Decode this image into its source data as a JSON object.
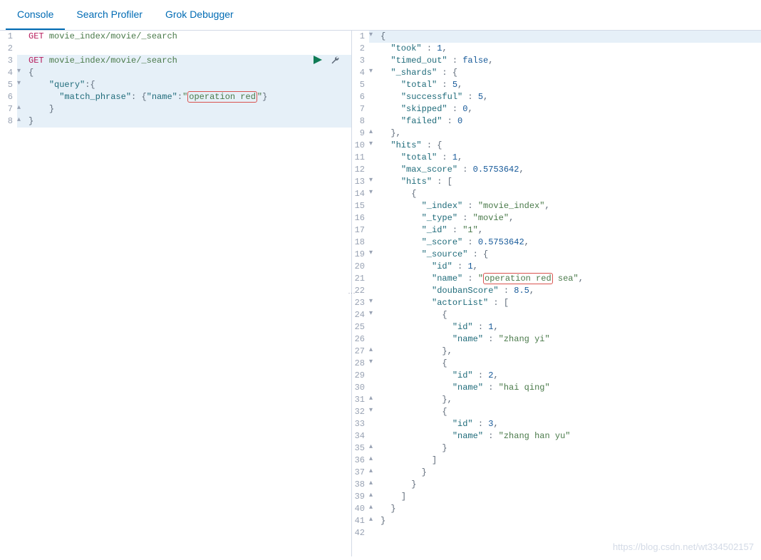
{
  "tabs": {
    "console": "Console",
    "profiler": "Search Profiler",
    "grok": "Grok Debugger"
  },
  "left": {
    "lines": [
      {
        "n": "1",
        "fold": "",
        "hl": false,
        "tokens": [
          [
            "method",
            "GET"
          ],
          [
            "plain",
            " "
          ],
          [
            "path",
            "movie_index/movie/_search"
          ]
        ]
      },
      {
        "n": "2",
        "fold": "",
        "hl": false,
        "tokens": []
      },
      {
        "n": "3",
        "fold": "",
        "hl": true,
        "tokens": [
          [
            "method",
            "GET"
          ],
          [
            "plain",
            " "
          ],
          [
            "path",
            "movie_index/movie/_search"
          ]
        ]
      },
      {
        "n": "4",
        "fold": "▾",
        "hl": true,
        "tokens": [
          [
            "punc",
            "{"
          ]
        ]
      },
      {
        "n": "5",
        "fold": "▾",
        "hl": true,
        "tokens": [
          [
            "plain",
            "    "
          ],
          [
            "key",
            "\"query\""
          ],
          [
            "punc",
            ":{"
          ]
        ]
      },
      {
        "n": "6",
        "fold": "",
        "hl": true,
        "tokens": [
          [
            "plain",
            "      "
          ],
          [
            "key",
            "\"match_phrase\""
          ],
          [
            "punc",
            ": {"
          ],
          [
            "key",
            "\"name\""
          ],
          [
            "punc",
            ":"
          ],
          [
            "str",
            "\""
          ],
          [
            "strbox",
            "operation red"
          ],
          [
            "str",
            "\""
          ],
          [
            "punc",
            "}"
          ]
        ]
      },
      {
        "n": "7",
        "fold": "▴",
        "hl": true,
        "tokens": [
          [
            "plain",
            "    "
          ],
          [
            "punc",
            "}"
          ]
        ]
      },
      {
        "n": "8",
        "fold": "▴",
        "hl": true,
        "tokens": [
          [
            "punc",
            "}"
          ]
        ]
      }
    ]
  },
  "right": {
    "lines": [
      {
        "n": "1",
        "fold": "▾",
        "tokens": [
          [
            "punc",
            "{"
          ]
        ],
        "hl": true
      },
      {
        "n": "2",
        "fold": "",
        "tokens": [
          [
            "plain",
            "  "
          ],
          [
            "key",
            "\"took\""
          ],
          [
            "punc",
            " : "
          ],
          [
            "num",
            "1"
          ],
          [
            "punc",
            ","
          ]
        ]
      },
      {
        "n": "3",
        "fold": "",
        "tokens": [
          [
            "plain",
            "  "
          ],
          [
            "key",
            "\"timed_out\""
          ],
          [
            "punc",
            " : "
          ],
          [
            "bool",
            "false"
          ],
          [
            "punc",
            ","
          ]
        ]
      },
      {
        "n": "4",
        "fold": "▾",
        "tokens": [
          [
            "plain",
            "  "
          ],
          [
            "key",
            "\"_shards\""
          ],
          [
            "punc",
            " : {"
          ]
        ]
      },
      {
        "n": "5",
        "fold": "",
        "tokens": [
          [
            "plain",
            "    "
          ],
          [
            "key",
            "\"total\""
          ],
          [
            "punc",
            " : "
          ],
          [
            "num",
            "5"
          ],
          [
            "punc",
            ","
          ]
        ]
      },
      {
        "n": "6",
        "fold": "",
        "tokens": [
          [
            "plain",
            "    "
          ],
          [
            "key",
            "\"successful\""
          ],
          [
            "punc",
            " : "
          ],
          [
            "num",
            "5"
          ],
          [
            "punc",
            ","
          ]
        ]
      },
      {
        "n": "7",
        "fold": "",
        "tokens": [
          [
            "plain",
            "    "
          ],
          [
            "key",
            "\"skipped\""
          ],
          [
            "punc",
            " : "
          ],
          [
            "num",
            "0"
          ],
          [
            "punc",
            ","
          ]
        ]
      },
      {
        "n": "8",
        "fold": "",
        "tokens": [
          [
            "plain",
            "    "
          ],
          [
            "key",
            "\"failed\""
          ],
          [
            "punc",
            " : "
          ],
          [
            "num",
            "0"
          ]
        ]
      },
      {
        "n": "9",
        "fold": "▴",
        "tokens": [
          [
            "plain",
            "  "
          ],
          [
            "punc",
            "},"
          ]
        ]
      },
      {
        "n": "10",
        "fold": "▾",
        "tokens": [
          [
            "plain",
            "  "
          ],
          [
            "key",
            "\"hits\""
          ],
          [
            "punc",
            " : {"
          ]
        ]
      },
      {
        "n": "11",
        "fold": "",
        "tokens": [
          [
            "plain",
            "    "
          ],
          [
            "key",
            "\"total\""
          ],
          [
            "punc",
            " : "
          ],
          [
            "num",
            "1"
          ],
          [
            "punc",
            ","
          ]
        ]
      },
      {
        "n": "12",
        "fold": "",
        "tokens": [
          [
            "plain",
            "    "
          ],
          [
            "key",
            "\"max_score\""
          ],
          [
            "punc",
            " : "
          ],
          [
            "num",
            "0.5753642"
          ],
          [
            "punc",
            ","
          ]
        ]
      },
      {
        "n": "13",
        "fold": "▾",
        "tokens": [
          [
            "plain",
            "    "
          ],
          [
            "key",
            "\"hits\""
          ],
          [
            "punc",
            " : ["
          ]
        ]
      },
      {
        "n": "14",
        "fold": "▾",
        "tokens": [
          [
            "plain",
            "      "
          ],
          [
            "punc",
            "{"
          ]
        ]
      },
      {
        "n": "15",
        "fold": "",
        "tokens": [
          [
            "plain",
            "        "
          ],
          [
            "key",
            "\"_index\""
          ],
          [
            "punc",
            " : "
          ],
          [
            "str",
            "\"movie_index\""
          ],
          [
            "punc",
            ","
          ]
        ]
      },
      {
        "n": "16",
        "fold": "",
        "tokens": [
          [
            "plain",
            "        "
          ],
          [
            "key",
            "\"_type\""
          ],
          [
            "punc",
            " : "
          ],
          [
            "str",
            "\"movie\""
          ],
          [
            "punc",
            ","
          ]
        ]
      },
      {
        "n": "17",
        "fold": "",
        "tokens": [
          [
            "plain",
            "        "
          ],
          [
            "key",
            "\"_id\""
          ],
          [
            "punc",
            " : "
          ],
          [
            "str",
            "\"1\""
          ],
          [
            "punc",
            ","
          ]
        ]
      },
      {
        "n": "18",
        "fold": "",
        "tokens": [
          [
            "plain",
            "        "
          ],
          [
            "key",
            "\"_score\""
          ],
          [
            "punc",
            " : "
          ],
          [
            "num",
            "0.5753642"
          ],
          [
            "punc",
            ","
          ]
        ]
      },
      {
        "n": "19",
        "fold": "▾",
        "tokens": [
          [
            "plain",
            "        "
          ],
          [
            "key",
            "\"_source\""
          ],
          [
            "punc",
            " : {"
          ]
        ]
      },
      {
        "n": "20",
        "fold": "",
        "tokens": [
          [
            "plain",
            "          "
          ],
          [
            "key",
            "\"id\""
          ],
          [
            "punc",
            " : "
          ],
          [
            "num",
            "1"
          ],
          [
            "punc",
            ","
          ]
        ]
      },
      {
        "n": "21",
        "fold": "",
        "tokens": [
          [
            "plain",
            "          "
          ],
          [
            "key",
            "\"name\""
          ],
          [
            "punc",
            " : "
          ],
          [
            "str",
            "\""
          ],
          [
            "strbox",
            "operation red"
          ],
          [
            "str",
            " sea\""
          ],
          [
            "punc",
            ","
          ]
        ]
      },
      {
        "n": "22",
        "fold": "",
        "tokens": [
          [
            "plain",
            "          "
          ],
          [
            "key",
            "\"doubanScore\""
          ],
          [
            "punc",
            " : "
          ],
          [
            "num",
            "8.5"
          ],
          [
            "punc",
            ","
          ]
        ]
      },
      {
        "n": "23",
        "fold": "▾",
        "tokens": [
          [
            "plain",
            "          "
          ],
          [
            "key",
            "\"actorList\""
          ],
          [
            "punc",
            " : ["
          ]
        ]
      },
      {
        "n": "24",
        "fold": "▾",
        "tokens": [
          [
            "plain",
            "            "
          ],
          [
            "punc",
            "{"
          ]
        ]
      },
      {
        "n": "25",
        "fold": "",
        "tokens": [
          [
            "plain",
            "              "
          ],
          [
            "key",
            "\"id\""
          ],
          [
            "punc",
            " : "
          ],
          [
            "num",
            "1"
          ],
          [
            "punc",
            ","
          ]
        ]
      },
      {
        "n": "26",
        "fold": "",
        "tokens": [
          [
            "plain",
            "              "
          ],
          [
            "key",
            "\"name\""
          ],
          [
            "punc",
            " : "
          ],
          [
            "str",
            "\"zhang yi\""
          ]
        ]
      },
      {
        "n": "27",
        "fold": "▴",
        "tokens": [
          [
            "plain",
            "            "
          ],
          [
            "punc",
            "},"
          ]
        ]
      },
      {
        "n": "28",
        "fold": "▾",
        "tokens": [
          [
            "plain",
            "            "
          ],
          [
            "punc",
            "{"
          ]
        ]
      },
      {
        "n": "29",
        "fold": "",
        "tokens": [
          [
            "plain",
            "              "
          ],
          [
            "key",
            "\"id\""
          ],
          [
            "punc",
            " : "
          ],
          [
            "num",
            "2"
          ],
          [
            "punc",
            ","
          ]
        ]
      },
      {
        "n": "30",
        "fold": "",
        "tokens": [
          [
            "plain",
            "              "
          ],
          [
            "key",
            "\"name\""
          ],
          [
            "punc",
            " : "
          ],
          [
            "str",
            "\"hai qing\""
          ]
        ]
      },
      {
        "n": "31",
        "fold": "▴",
        "tokens": [
          [
            "plain",
            "            "
          ],
          [
            "punc",
            "},"
          ]
        ]
      },
      {
        "n": "32",
        "fold": "▾",
        "tokens": [
          [
            "plain",
            "            "
          ],
          [
            "punc",
            "{"
          ]
        ]
      },
      {
        "n": "33",
        "fold": "",
        "tokens": [
          [
            "plain",
            "              "
          ],
          [
            "key",
            "\"id\""
          ],
          [
            "punc",
            " : "
          ],
          [
            "num",
            "3"
          ],
          [
            "punc",
            ","
          ]
        ]
      },
      {
        "n": "34",
        "fold": "",
        "tokens": [
          [
            "plain",
            "              "
          ],
          [
            "key",
            "\"name\""
          ],
          [
            "punc",
            " : "
          ],
          [
            "str",
            "\"zhang han yu\""
          ]
        ]
      },
      {
        "n": "35",
        "fold": "▴",
        "tokens": [
          [
            "plain",
            "            "
          ],
          [
            "punc",
            "}"
          ]
        ]
      },
      {
        "n": "36",
        "fold": "▴",
        "tokens": [
          [
            "plain",
            "          "
          ],
          [
            "punc",
            "]"
          ]
        ]
      },
      {
        "n": "37",
        "fold": "▴",
        "tokens": [
          [
            "plain",
            "        "
          ],
          [
            "punc",
            "}"
          ]
        ]
      },
      {
        "n": "38",
        "fold": "▴",
        "tokens": [
          [
            "plain",
            "      "
          ],
          [
            "punc",
            "}"
          ]
        ]
      },
      {
        "n": "39",
        "fold": "▴",
        "tokens": [
          [
            "plain",
            "    "
          ],
          [
            "punc",
            "]"
          ]
        ]
      },
      {
        "n": "40",
        "fold": "▴",
        "tokens": [
          [
            "plain",
            "  "
          ],
          [
            "punc",
            "}"
          ]
        ]
      },
      {
        "n": "41",
        "fold": "▴",
        "tokens": [
          [
            "punc",
            "}"
          ]
        ]
      },
      {
        "n": "42",
        "fold": "",
        "tokens": []
      }
    ]
  },
  "watermark": "https://blog.csdn.net/wt334502157"
}
